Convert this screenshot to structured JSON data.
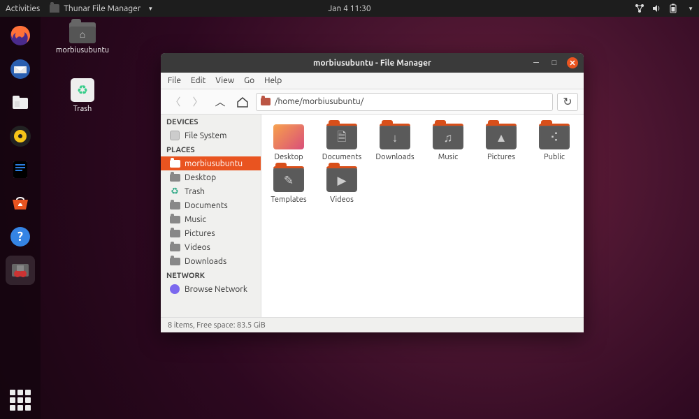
{
  "topbar": {
    "activities": "Activities",
    "app_name": "Thunar File Manager",
    "clock": "Jan 4  11:30"
  },
  "desktop": {
    "home_label": "morbiusubuntu",
    "trash_label": "Trash"
  },
  "window": {
    "title": "morbiusubuntu - File Manager",
    "menus": [
      "File",
      "Edit",
      "View",
      "Go",
      "Help"
    ],
    "location_path": "/home/morbiusubuntu/",
    "statusbar": "8 items, Free space: 83.5 GiB"
  },
  "sidebar": {
    "devices_header": "DEVICES",
    "devices": [
      {
        "label": "File System",
        "icon": "disk"
      }
    ],
    "places_header": "PLACES",
    "places": [
      {
        "label": "morbiusubuntu",
        "icon": "user",
        "selected": true
      },
      {
        "label": "Desktop",
        "icon": "folder"
      },
      {
        "label": "Trash",
        "icon": "trash"
      },
      {
        "label": "Documents",
        "icon": "folder"
      },
      {
        "label": "Music",
        "icon": "folder"
      },
      {
        "label": "Pictures",
        "icon": "folder"
      },
      {
        "label": "Videos",
        "icon": "folder"
      },
      {
        "label": "Downloads",
        "icon": "folder"
      }
    ],
    "network_header": "NETWORK",
    "network": [
      {
        "label": "Browse Network",
        "icon": "net"
      }
    ]
  },
  "folders": [
    {
      "name": "Desktop",
      "glyph": "",
      "variant": "desktop"
    },
    {
      "name": "Documents",
      "glyph": "🗎"
    },
    {
      "name": "Downloads",
      "glyph": "↓"
    },
    {
      "name": "Music",
      "glyph": "♫"
    },
    {
      "name": "Pictures",
      "glyph": "▲"
    },
    {
      "name": "Public",
      "glyph": "⠪"
    },
    {
      "name": "Templates",
      "glyph": "✎"
    },
    {
      "name": "Videos",
      "glyph": "▶"
    }
  ]
}
